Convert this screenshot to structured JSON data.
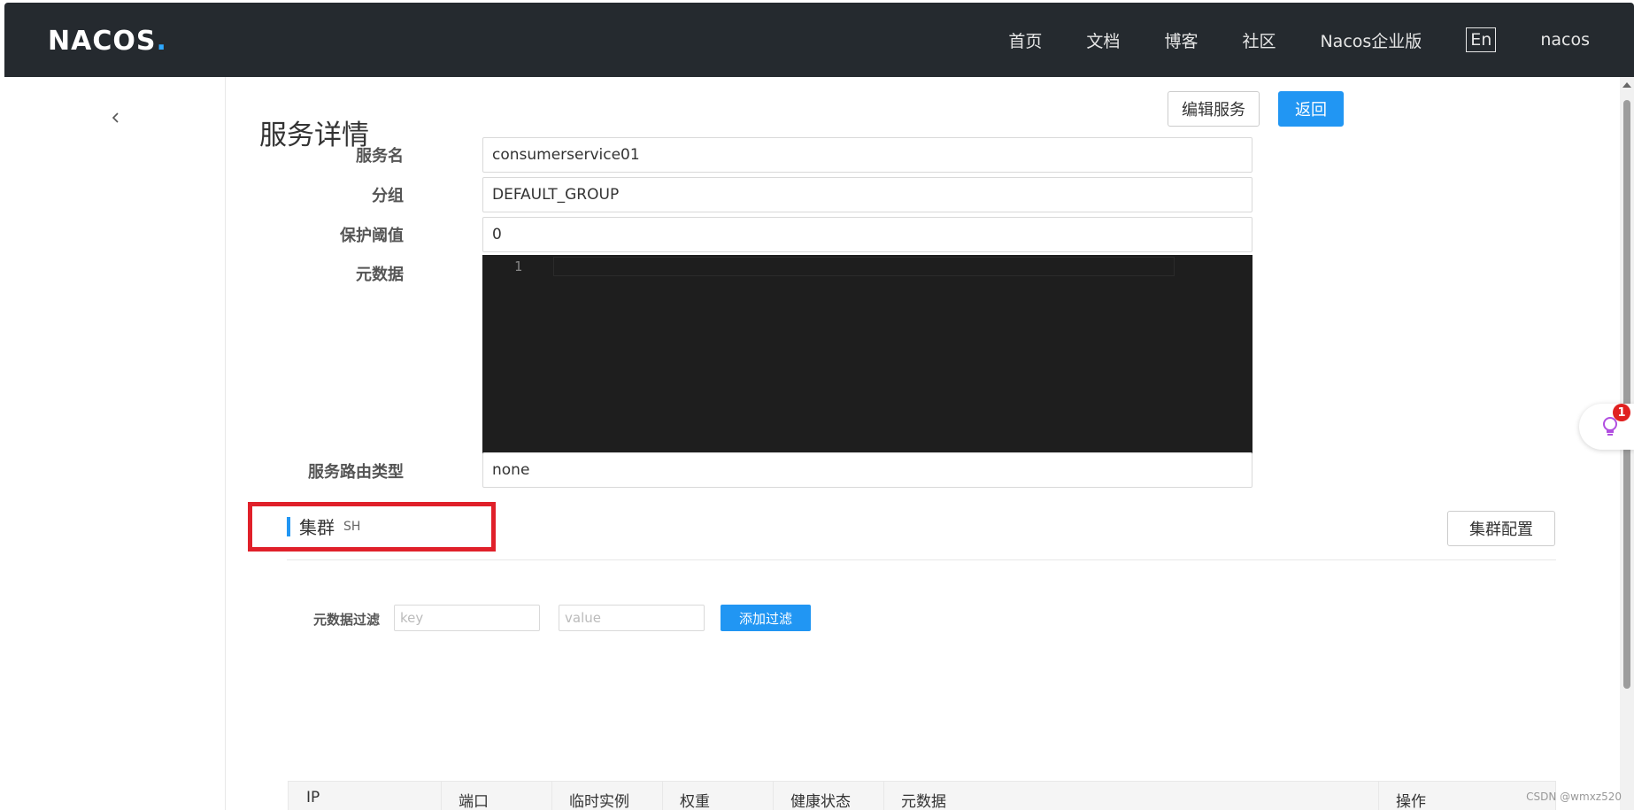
{
  "header": {
    "logo": "NACOS",
    "logo_dot": ".",
    "nav": [
      "首页",
      "文档",
      "博客",
      "社区",
      "Nacos企业版"
    ],
    "lang": "En",
    "user": "nacos"
  },
  "sidebar": {
    "back_icon": "chevron-left-icon"
  },
  "page": {
    "title": "服务详情",
    "edit_button": "编辑服务",
    "back_button": "返回"
  },
  "form": {
    "service_name_label": "服务名",
    "service_name_value": "consumerservice01",
    "group_label": "分组",
    "group_value": "DEFAULT_GROUP",
    "protect_threshold_label": "保护阈值",
    "protect_threshold_value": "0",
    "metadata_label": "元数据",
    "editor_line_number": "1",
    "selector_label": "服务路由类型",
    "selector_value": "none"
  },
  "cluster": {
    "title": "集群",
    "name": "SH",
    "config_button": "集群配置",
    "filter_label": "元数据过滤",
    "key_placeholder": "key",
    "value_placeholder": "value",
    "add_filter_button": "添加过滤"
  },
  "table": {
    "columns": [
      "IP",
      "端口",
      "临时实例",
      "权重",
      "健康状态",
      "元数据",
      "操作"
    ]
  },
  "widget": {
    "badge": "1",
    "icon": "lightbulb-icon"
  },
  "watermark": "CSDN @wmxz520",
  "colors": {
    "topbar": "#252a2f",
    "primary": "#2196f3",
    "highlight_box": "#e0202a",
    "editor_bg": "#1e1e1e"
  }
}
